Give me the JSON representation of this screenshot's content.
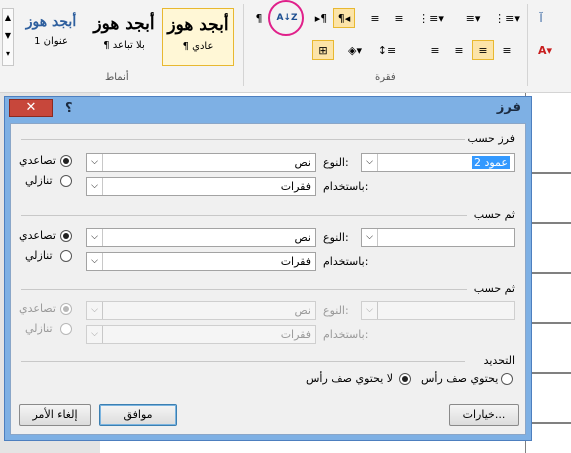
{
  "ribbon": {
    "styles": [
      {
        "preview": "أبجد هوز",
        "name": "¶ عادي"
      },
      {
        "preview": "أبجد هوز",
        "name": "¶ بلا تباعد"
      },
      {
        "preview": "أبجد هوز",
        "name": "عنوان 1"
      }
    ],
    "group_styles": "أنماط",
    "group_paragraph": "فقرة",
    "pilcrow": "¶",
    "sort_icon_text": "A↓Z"
  },
  "dialog": {
    "title": "فرز",
    "help": "؟",
    "close": "✕",
    "sort_by": {
      "label": "فرز حسب",
      "field": "عمود 2",
      "type_label": "النوع:",
      "type": "نص",
      "using_label": "باستخدام:",
      "using": "فقرات",
      "asc": "تصاعدي",
      "desc": "تنازلي"
    },
    "then_by_1": {
      "label": "ثم حسب",
      "field": "",
      "type_label": "النوع:",
      "type": "نص",
      "using_label": "باستخدام:",
      "using": "فقرات",
      "asc": "تصاعدي",
      "desc": "تنازلي"
    },
    "then_by_2": {
      "label": "ثم حسب",
      "field": "",
      "type_label": "النوع:",
      "type": "نص",
      "using_label": "باستخدام:",
      "using": "فقرات",
      "asc": "تصاعدي",
      "desc": "تنازلي"
    },
    "header_row": {
      "label": "التحديد",
      "has_header": "يحتوي صف رأس",
      "no_header": "لا يحتوي صف رأس"
    },
    "buttons": {
      "options": "خيارات...",
      "ok": "موافق",
      "cancel": "إلغاء الأمر"
    }
  },
  "colors": {
    "accent": "#e0208a",
    "dialog_frame": "#7eb0e4",
    "selection": "#3399ff"
  }
}
